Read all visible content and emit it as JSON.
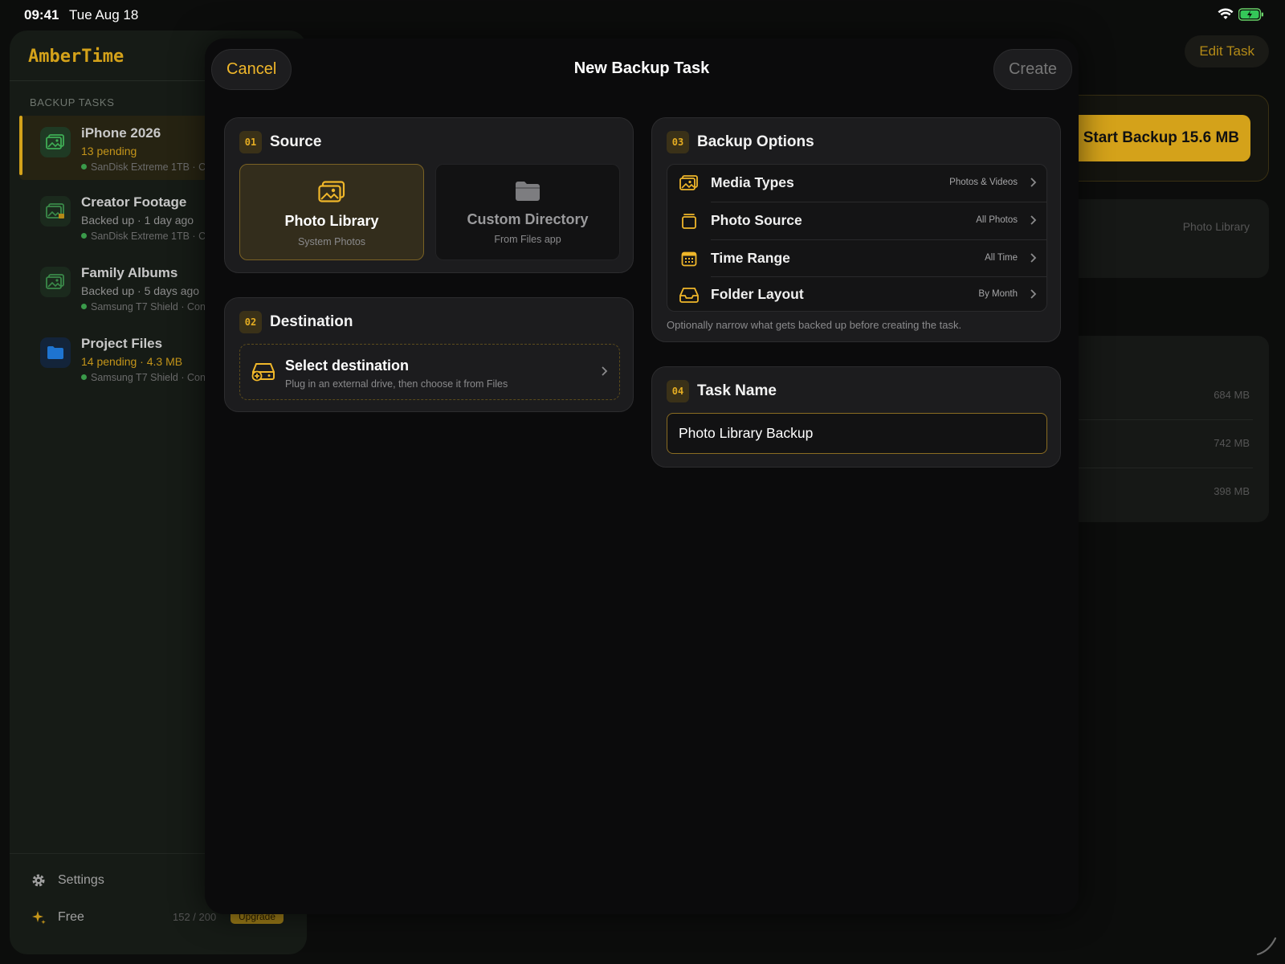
{
  "status_bar": {
    "time": "09:41",
    "date": "Tue Aug 18"
  },
  "sidebar": {
    "brand": "AmberTime",
    "section_label": "BACKUP TASKS",
    "tasks": [
      {
        "name": "iPhone 2026",
        "status": "13 pending",
        "drive": "SanDisk Extreme 1TB · C",
        "icon": "photo-library-icon"
      },
      {
        "name": "Creator Footage",
        "status": "Backed up · 1 day ago",
        "drive": "SanDisk Extreme 1TB · C",
        "icon": "photo-library-icon"
      },
      {
        "name": "Family Albums",
        "status": "Backed up · 5 days ago",
        "drive": "Samsung T7 Shield · Con",
        "icon": "photo-library-icon"
      },
      {
        "name": "Project Files",
        "status": "14 pending · 4.3 MB",
        "drive": "Samsung T7 Shield · Con",
        "icon": "folder-icon"
      }
    ],
    "settings_label": "Settings",
    "plan_label": "Free",
    "quota": "152 / 200",
    "upgrade_label": "Upgrade"
  },
  "main": {
    "edit_task_label": "Edit Task",
    "start_backup_label": "Start Backup 15.6 MB",
    "source_value": "Photo Library",
    "sizes": [
      "684 MB",
      "742 MB",
      "398 MB"
    ]
  },
  "modal": {
    "title": "New Backup Task",
    "cancel_label": "Cancel",
    "create_label": "Create",
    "source": {
      "number": "01",
      "title": "Source",
      "options": [
        {
          "label": "Photo Library",
          "sub": "System Photos"
        },
        {
          "label": "Custom Directory",
          "sub": "From Files app"
        }
      ]
    },
    "destination": {
      "number": "02",
      "title": "Destination",
      "label": "Select destination",
      "sub": "Plug in an external drive, then choose it from Files"
    },
    "options": {
      "number": "03",
      "title": "Backup Options",
      "rows": [
        {
          "label": "Media Types",
          "value": "Photos & Videos"
        },
        {
          "label": "Photo Source",
          "value": "All Photos"
        },
        {
          "label": "Time Range",
          "value": "All Time"
        },
        {
          "label": "Folder Layout",
          "value": "By Month"
        }
      ],
      "note": "Optionally narrow what gets backed up before creating the task."
    },
    "task_name": {
      "number": "04",
      "title": "Task Name",
      "value": "Photo Library Backup"
    }
  },
  "colors": {
    "accent": "#d4a21a",
    "accent_text": "#f0b72a",
    "card": "#1c1c1e",
    "background": "#0b0b0c"
  }
}
